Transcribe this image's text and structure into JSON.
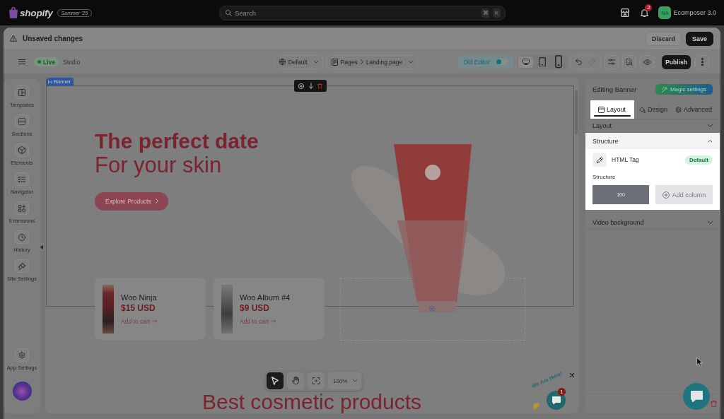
{
  "top_bar": {
    "brand": "shopify",
    "edition": "Summer '25",
    "search": {
      "placeholder": "Search",
      "keys": [
        "⌘",
        "K"
      ]
    },
    "notification_count": "2",
    "account": {
      "initials": "NA",
      "name": "Ecomposer 3.0"
    }
  },
  "header": {
    "title": "Unsaved changes",
    "buttons": [
      {
        "label": "Discard",
        "kind": "secondary"
      },
      {
        "label": "Save",
        "kind": "primary"
      }
    ]
  },
  "toolbar": {
    "status": "Live",
    "mode": "Studio",
    "locale": "Default",
    "breadcrumb": [
      "Pages",
      "Landing page"
    ],
    "old_editor": {
      "label": "Old Editor",
      "on": false
    },
    "devices": [
      {
        "kind": "desktop",
        "selected": true
      },
      {
        "kind": "tablet",
        "selected": false
      },
      {
        "kind": "mobile",
        "selected": false
      }
    ],
    "history_buttons": [
      {
        "kind": "undo",
        "disabled": false
      },
      {
        "kind": "redo",
        "disabled": true
      }
    ],
    "publish": "Publish"
  },
  "sidebar": {
    "items": [
      {
        "label": "Templates",
        "kind": "templates"
      },
      {
        "label": "Sections",
        "kind": "sections"
      },
      {
        "label": "Elements",
        "kind": "elements"
      },
      {
        "label": "Navigator",
        "kind": "navigator"
      },
      {
        "label": "Extensions",
        "kind": "extensions"
      },
      {
        "label": "History",
        "kind": "history"
      },
      {
        "label": "Site Settings",
        "kind": "site-settings"
      }
    ],
    "footer": {
      "label": "App Settings"
    }
  },
  "canvas": {
    "section_tag": "Banner",
    "headline": "The perfect date",
    "subheadline": "For your skin",
    "cta": "Explore Products",
    "products": [
      {
        "name": "Woo Ninja",
        "price": "$15 USD",
        "action": "Add to cart"
      },
      {
        "name": "Woo Album #4",
        "price": "$9 USD",
        "action": "Add to cart"
      }
    ],
    "next_heading": "Best cosmetic products",
    "zoom_tools": [
      {
        "kind": "select",
        "selected": true
      },
      {
        "kind": "hand",
        "selected": false
      },
      {
        "kind": "fit",
        "selected": false
      }
    ],
    "zoom": "100%",
    "chat_widget": {
      "caption": "We Are Here!",
      "badge": "1"
    }
  },
  "panel": {
    "title": "Editing Banner",
    "magic_button": "Magic settings",
    "tabs": [
      {
        "label": "Layout",
        "kind": "layout",
        "selected": true,
        "highlighted": true
      },
      {
        "label": "Design",
        "kind": "design",
        "selected": false,
        "highlighted": false
      },
      {
        "label": "Advanced",
        "kind": "advanced",
        "selected": false,
        "highlighted": false
      }
    ],
    "sections": [
      {
        "title": "Layout",
        "expanded": false,
        "highlighted": false
      },
      {
        "title": "Structure",
        "expanded": true,
        "highlighted": true,
        "html_tag": {
          "label": "HTML Tag",
          "value": "Default"
        },
        "structure_label": "Structure",
        "columns": [
          "100"
        ],
        "add_column": "Add column"
      },
      {
        "title": "Video background",
        "expanded": false,
        "highlighted": false
      }
    ]
  }
}
